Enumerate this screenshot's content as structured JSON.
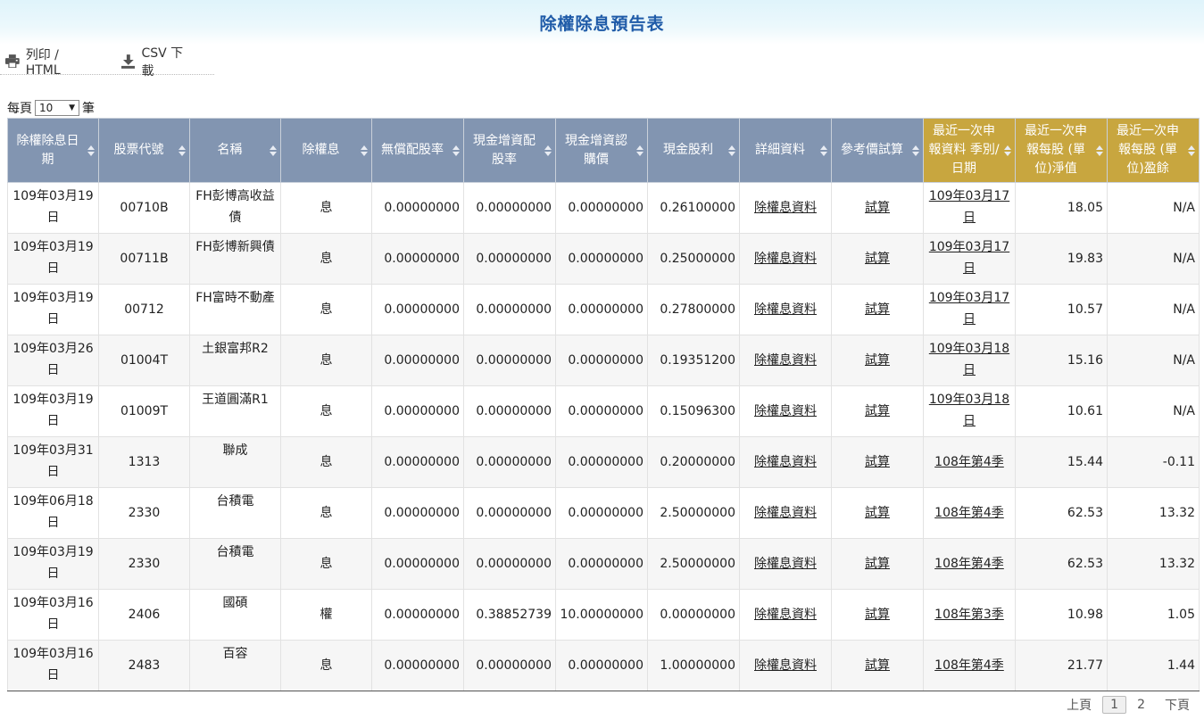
{
  "page": {
    "title": "除權除息預告表"
  },
  "toolbar": {
    "print_label": "列印 / HTML",
    "csv_label": "CSV 下載"
  },
  "perpage": {
    "prefix": "每頁",
    "value": "10",
    "suffix": "筆"
  },
  "table": {
    "headers": [
      "除權除息日期",
      "股票代號",
      "名稱",
      "除權息",
      "無償配股率",
      "現金增資配股率",
      "現金增資認購價",
      "現金股利",
      "詳細資料",
      "參考價試算",
      "最近一次申報資料 季別/日期",
      "最近一次申報每股 (單位)淨值",
      "最近一次申報每股 (單位)盈餘"
    ],
    "rows": [
      {
        "date": "109年03月19日",
        "code": "00710B",
        "name": "FH彭博高收益債",
        "type": "息",
        "bonus": "0.00000000",
        "cash_cap": "0.00000000",
        "sub_price": "0.00000000",
        "dividend": "0.26100000",
        "detail": "除權息資料",
        "calc": "試算",
        "report": "109年03月17日",
        "nav": "18.05",
        "eps": "N/A"
      },
      {
        "date": "109年03月19日",
        "code": "00711B",
        "name": "FH彭博新興債",
        "type": "息",
        "bonus": "0.00000000",
        "cash_cap": "0.00000000",
        "sub_price": "0.00000000",
        "dividend": "0.25000000",
        "detail": "除權息資料",
        "calc": "試算",
        "report": "109年03月17日",
        "nav": "19.83",
        "eps": "N/A"
      },
      {
        "date": "109年03月19日",
        "code": "00712",
        "name": "FH富時不動產",
        "type": "息",
        "bonus": "0.00000000",
        "cash_cap": "0.00000000",
        "sub_price": "0.00000000",
        "dividend": "0.27800000",
        "detail": "除權息資料",
        "calc": "試算",
        "report": "109年03月17日",
        "nav": "10.57",
        "eps": "N/A"
      },
      {
        "date": "109年03月26日",
        "code": "01004T",
        "name": "土銀富邦R2",
        "type": "息",
        "bonus": "0.00000000",
        "cash_cap": "0.00000000",
        "sub_price": "0.00000000",
        "dividend": "0.19351200",
        "detail": "除權息資料",
        "calc": "試算",
        "report": "109年03月18日",
        "nav": "15.16",
        "eps": "N/A"
      },
      {
        "date": "109年03月19日",
        "code": "01009T",
        "name": "王道圓滿R1",
        "type": "息",
        "bonus": "0.00000000",
        "cash_cap": "0.00000000",
        "sub_price": "0.00000000",
        "dividend": "0.15096300",
        "detail": "除權息資料",
        "calc": "試算",
        "report": "109年03月18日",
        "nav": "10.61",
        "eps": "N/A"
      },
      {
        "date": "109年03月31日",
        "code": "1313",
        "name": "聯成",
        "type": "息",
        "bonus": "0.00000000",
        "cash_cap": "0.00000000",
        "sub_price": "0.00000000",
        "dividend": "0.20000000",
        "detail": "除權息資料",
        "calc": "試算",
        "report": "108年第4季",
        "nav": "15.44",
        "eps": "-0.11"
      },
      {
        "date": "109年06月18日",
        "code": "2330",
        "name": "台積電",
        "type": "息",
        "bonus": "0.00000000",
        "cash_cap": "0.00000000",
        "sub_price": "0.00000000",
        "dividend": "2.50000000",
        "detail": "除權息資料",
        "calc": "試算",
        "report": "108年第4季",
        "nav": "62.53",
        "eps": "13.32"
      },
      {
        "date": "109年03月19日",
        "code": "2330",
        "name": "台積電",
        "type": "息",
        "bonus": "0.00000000",
        "cash_cap": "0.00000000",
        "sub_price": "0.00000000",
        "dividend": "2.50000000",
        "detail": "除權息資料",
        "calc": "試算",
        "report": "108年第4季",
        "nav": "62.53",
        "eps": "13.32"
      },
      {
        "date": "109年03月16日",
        "code": "2406",
        "name": "國碩",
        "type": "權",
        "bonus": "0.00000000",
        "cash_cap": "0.38852739",
        "sub_price": "10.00000000",
        "dividend": "0.00000000",
        "detail": "除權息資料",
        "calc": "試算",
        "report": "108年第3季",
        "nav": "10.98",
        "eps": "1.05"
      },
      {
        "date": "109年03月16日",
        "code": "2483",
        "name": "百容",
        "type": "息",
        "bonus": "0.00000000",
        "cash_cap": "0.00000000",
        "sub_price": "0.00000000",
        "dividend": "1.00000000",
        "detail": "除權息資料",
        "calc": "試算",
        "report": "108年第4季",
        "nav": "21.77",
        "eps": "1.44"
      }
    ]
  },
  "pager": {
    "prev": "上頁",
    "current": "1",
    "page2": "2",
    "next": "下頁"
  },
  "colors": {
    "header_blue": "#8295b1",
    "header_gold": "#c8a63f",
    "title": "#1f5ba8"
  }
}
